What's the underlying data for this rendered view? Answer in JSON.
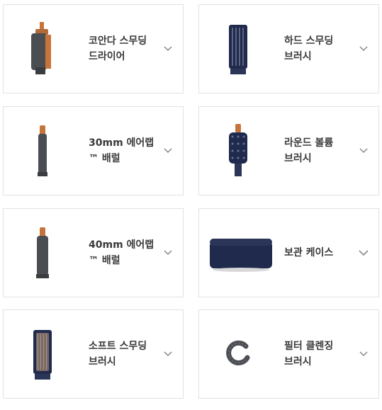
{
  "items": [
    {
      "label": "코안다 스무딩\n드라이어",
      "icon": "coanda-smoothing-dryer-icon"
    },
    {
      "label": "하드 스무딩\n브러시",
      "icon": "firm-smoothing-brush-icon"
    },
    {
      "label": "30mm 에어랩\n™ 배럴",
      "icon": "30mm-barrel-icon"
    },
    {
      "label": "라운드 볼륨\n브러시",
      "icon": "round-volume-brush-icon"
    },
    {
      "label": "40mm 에어랩\n™ 배럴",
      "icon": "40mm-barrel-icon"
    },
    {
      "label": "보관 케이스",
      "icon": "storage-case-icon"
    },
    {
      "label": "소프트 스무딩\n브러시",
      "icon": "soft-smoothing-brush-icon"
    },
    {
      "label": "필터 클렌징\n브러시",
      "icon": "filter-cleaning-brush-icon"
    }
  ],
  "colors": {
    "copper": "#c7743c",
    "gunmetal": "#4a4d52",
    "navy": "#1f2a4d",
    "border": "#e2e2e2",
    "chevron": "#888888"
  }
}
